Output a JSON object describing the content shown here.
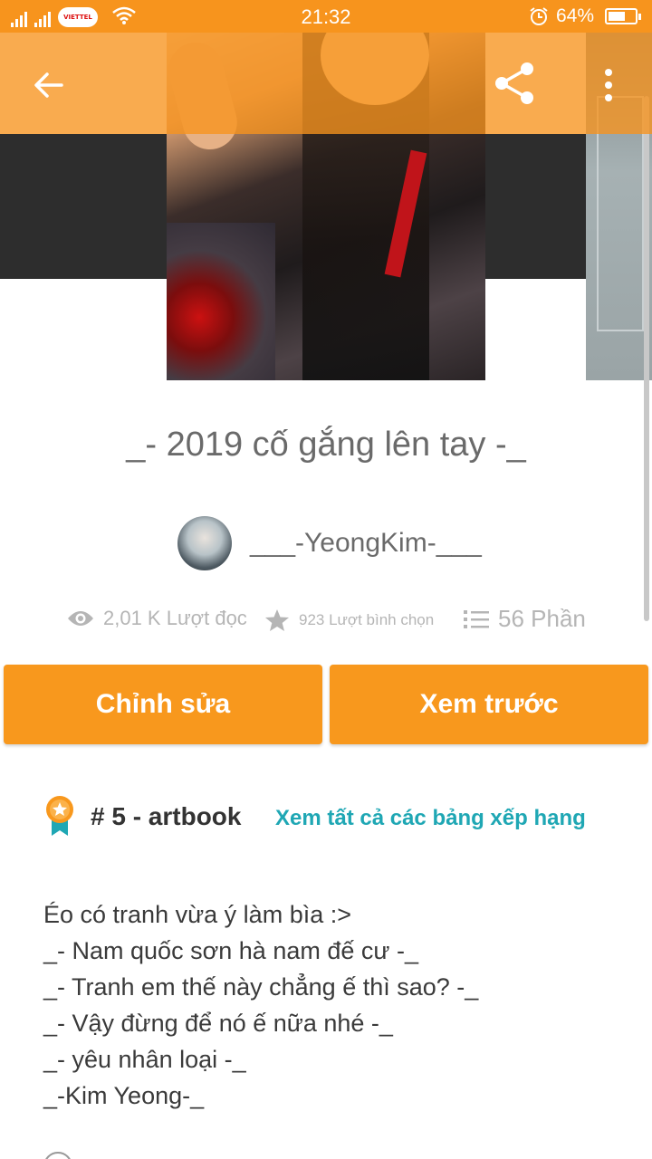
{
  "status_bar": {
    "carrier": "VIETTEL",
    "time": "21:32",
    "battery_percent": "64%",
    "battery_level": 0.64,
    "icons": [
      "signal-icon",
      "signal-icon",
      "wifi-icon",
      "alarm-icon",
      "battery-icon"
    ]
  },
  "app_bar": {
    "back_icon": "arrow-left-icon",
    "share_icon": "share-icon",
    "more_icon": "more-vertical-icon",
    "color": "#f7941d"
  },
  "story": {
    "title": "_- 2019 cố gắng lên tay -_",
    "author": "___-YeongKim-___",
    "stats": {
      "reads": "2,01 K Lượt đọc",
      "votes": "923 Lượt bình chọn",
      "parts": "56 Phần"
    }
  },
  "actions": {
    "edit_label": "Chỉnh sửa",
    "preview_label": "Xem trước",
    "color": "#f8981d"
  },
  "ranking": {
    "label": "# 5 - artbook",
    "link": "Xem tất cả các bảng xếp hạng",
    "link_color": "#1fa7b4"
  },
  "description": {
    "lines": [
      "Éo có tranh vừa ý làm bìa :>",
      "_- Nam quốc sơn hà nam đế cư -_",
      "_- Tranh em thế này chẳng ế thì sao? -_",
      "_- Vậy đừng để nó ế nữa nhé -_",
      "_- yêu nhân loại -_",
      "_-Kim Yeong-_"
    ]
  }
}
